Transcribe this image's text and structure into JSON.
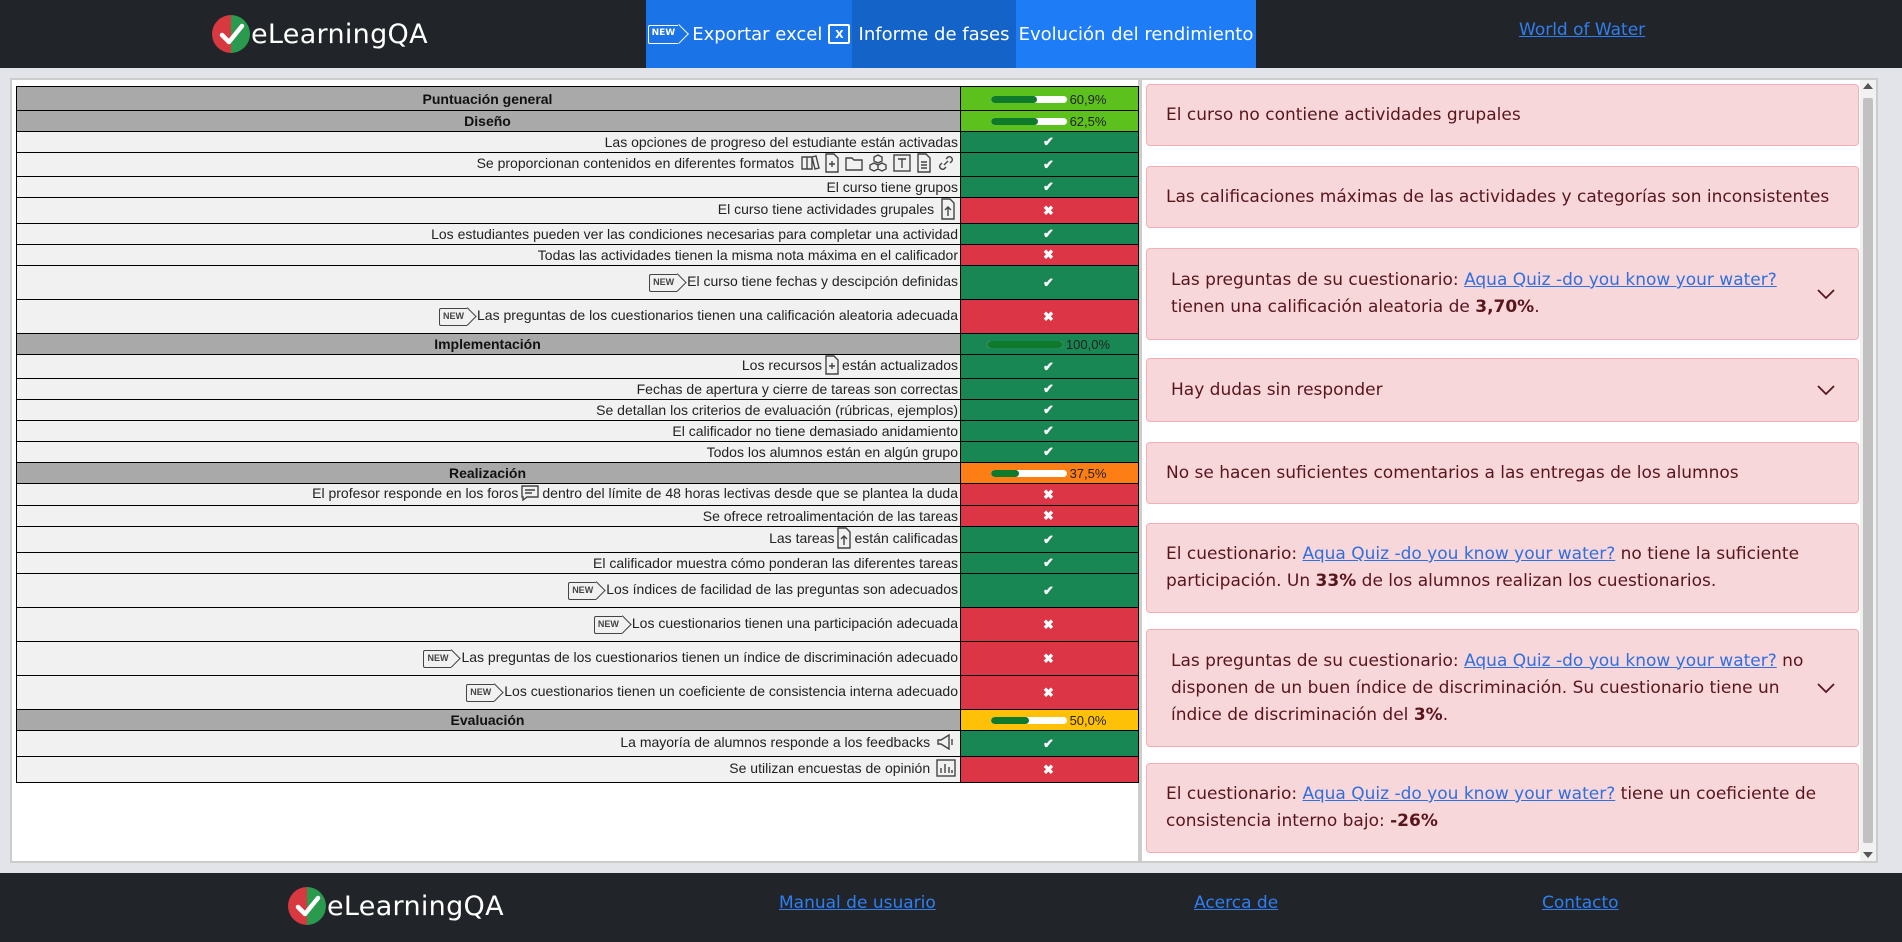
{
  "header": {
    "brand": "eLearningQA",
    "nav": {
      "export_label": "Exportar excel",
      "new_badge": "NEW",
      "phases_label": "Informe de fases",
      "performance_label": "Evolución del rendimiento"
    },
    "course_link": "World of Water"
  },
  "table": {
    "overall": {
      "label": "Puntuación general",
      "percent": "60,9%",
      "fraction": 0.609
    },
    "sections": [
      {
        "title": "Diseño",
        "percent": "62,5%",
        "fraction": 0.625,
        "color": "#5dc11d",
        "rows": [
          {
            "text": "Las opciones de progreso del estudiante están activadas",
            "ok": true
          },
          {
            "text": "Se proporcionan contenidos en diferentes formatos",
            "ok": true
          },
          {
            "text": "El curso tiene grupos",
            "ok": true
          },
          {
            "text": "El curso tiene actividades grupales",
            "ok": false
          },
          {
            "text": "Los estudiantes pueden ver las condiciones necesarias para completar una actividad",
            "ok": true
          },
          {
            "text": "Todas las actividades tienen la misma nota máxima en el calificador",
            "ok": false
          },
          {
            "text": "El curso tiene fechas y descipción definidas",
            "ok": true
          },
          {
            "text": "Las preguntas de los cuestionarios tienen una calificación aleatoria adecuada",
            "ok": false
          }
        ]
      },
      {
        "title": "Implementación",
        "percent": "100,0%",
        "fraction": 1.0,
        "color": "#198754",
        "rows": [
          {
            "text_a": "Los recursos",
            "text_b": "están actualizados",
            "ok": true
          },
          {
            "text": "Fechas de apertura y cierre de tareas son correctas",
            "ok": true
          },
          {
            "text": "Se detallan los criterios de evaluación (rúbricas, ejemplos)",
            "ok": true
          },
          {
            "text": "El calificador no tiene demasiado anidamiento",
            "ok": true
          },
          {
            "text": "Todos los alumnos están en algún grupo",
            "ok": true
          }
        ]
      },
      {
        "title": "Realización",
        "percent": "37,5%",
        "fraction": 0.375,
        "color": "#fd7e14",
        "rows": [
          {
            "text_a": "El profesor responde en los foros",
            "text_b": "dentro del límite de 48 horas lectivas desde que se plantea la duda",
            "ok": false
          },
          {
            "text": "Se ofrece retroalimentación de las tareas",
            "ok": false
          },
          {
            "text_a": "Las tareas",
            "text_b": "están calificadas",
            "ok": true
          },
          {
            "text": "El calificador muestra cómo ponderan las diferentes tareas",
            "ok": true
          },
          {
            "text": "Los índices de facilidad de las preguntas son adecuados",
            "ok": true
          },
          {
            "text": "Los cuestionarios tienen una participación adecuada",
            "ok": false
          },
          {
            "text": "Las preguntas de los cuestionarios tienen un índice de discriminación adecuado",
            "ok": false
          },
          {
            "text": "Los cuestionarios tienen un coeficiente de consistencia interna adecuado",
            "ok": false
          }
        ]
      },
      {
        "title": "Evaluación",
        "percent": "50,0%",
        "fraction": 0.5,
        "color": "#ffc107",
        "rows": [
          {
            "text": "La mayoría de alumnos responde a los feedbacks",
            "ok": true
          },
          {
            "text": "Se utilizan encuestas de opinión",
            "ok": false
          }
        ]
      }
    ],
    "check_mark": "✔",
    "cross_mark": "✖"
  },
  "alerts": [
    {
      "text": "El curso no contiene actividades grupales"
    },
    {
      "text": "Las calificaciones máximas de las actividades y categorías son inconsistentes"
    },
    {
      "pre": "Las preguntas de su cuestionario: ",
      "link": "Aqua Quiz -do you know your water?",
      "post": " tienen una calificación aleatoria de ",
      "bold": "3,70%",
      "end": "."
    },
    {
      "text": "Hay dudas sin responder"
    },
    {
      "text": "No se hacen suficientes comentarios a las entregas de los alumnos"
    },
    {
      "pre": "El cuestionario: ",
      "link": "Aqua Quiz -do you know your water?",
      "post": " no tiene la suficiente participación. Un ",
      "bold": "33%",
      "end": " de los alumnos realizan los cuestionarios."
    },
    {
      "pre": "Las preguntas de su cuestionario: ",
      "link": "Aqua Quiz -do you know your water?",
      "post": " no disponen de un buen índice de discriminación. Su cuestionario tiene un índice de discriminación del ",
      "bold": "3%",
      "end": "."
    },
    {
      "pre": "El cuestionario: ",
      "link": "Aqua Quiz -do you know your water?",
      "post": " tiene un coeficiente de consistencia interno bajo: ",
      "bold": "-26%",
      "end": ""
    }
  ],
  "footer": {
    "brand": "eLearningQA",
    "manual": "Manual de usuario",
    "about": "Acerca de",
    "contact": "Contacto"
  },
  "icon_names": [
    "logo-mark-icon",
    "new-badge-icon",
    "excel-icon",
    "check-icon",
    "cross-icon",
    "chevron-down-icon",
    "book-icon",
    "file-plus-icon",
    "folder-icon",
    "cubes-icon",
    "text-icon",
    "document-icon",
    "link-icon",
    "upload-file-icon",
    "chat-icon",
    "megaphone-icon",
    "bar-chart-icon"
  ]
}
